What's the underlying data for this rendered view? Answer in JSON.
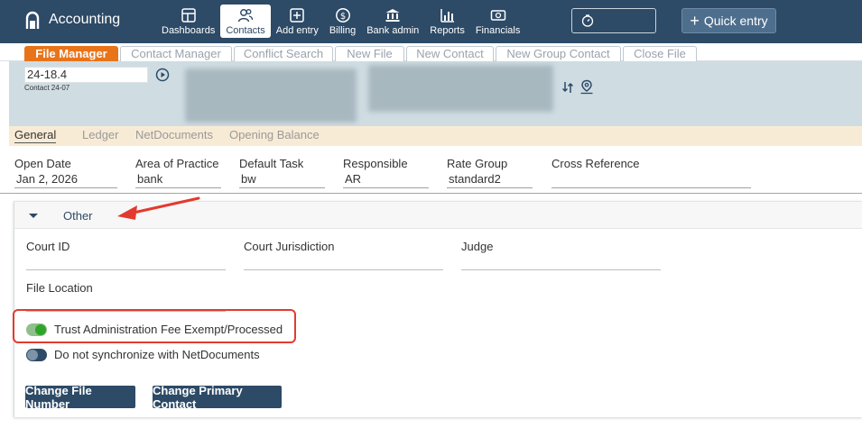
{
  "app": {
    "title": "Accounting",
    "nav": [
      {
        "label": "Dashboards",
        "icon": "dashboard-icon"
      },
      {
        "label": "Contacts",
        "icon": "contacts-icon",
        "active": true
      },
      {
        "label": "Add entry",
        "icon": "add-entry-icon"
      },
      {
        "label": "Billing",
        "icon": "billing-icon"
      },
      {
        "label": "Bank admin",
        "icon": "bank-icon"
      },
      {
        "label": "Reports",
        "icon": "reports-icon"
      },
      {
        "label": "Financials",
        "icon": "financials-icon"
      }
    ],
    "quick_entry_label": "Quick entry"
  },
  "tabs": [
    {
      "label": "File Manager",
      "active": true
    },
    {
      "label": "Contact Manager"
    },
    {
      "label": "Conflict Search"
    },
    {
      "label": "New File"
    },
    {
      "label": "New Contact"
    },
    {
      "label": "New Group Contact"
    },
    {
      "label": "Close File"
    }
  ],
  "file_header": {
    "file_number": "24-18.4",
    "contact_ref": "Contact 24-07"
  },
  "subtabs": [
    {
      "label": "General",
      "active": true
    },
    {
      "label": "Ledger"
    },
    {
      "label": "NetDocuments"
    },
    {
      "label": "Opening Balance"
    }
  ],
  "general_fields": [
    {
      "label": "Open Date",
      "value": "Jan 2, 2026"
    },
    {
      "label": "Area of Practice",
      "value": "bank"
    },
    {
      "label": "Default Task",
      "value": "bw"
    },
    {
      "label": "Responsible",
      "value": "AR"
    },
    {
      "label": "Rate Group",
      "value": "standard2"
    },
    {
      "label": "Cross Reference",
      "value": ""
    }
  ],
  "other": {
    "section_label": "Other",
    "fields": [
      {
        "label": "Court ID",
        "value": ""
      },
      {
        "label": "Court Jurisdiction",
        "value": ""
      },
      {
        "label": "Judge",
        "value": ""
      },
      {
        "label": "File Location",
        "value": ""
      }
    ],
    "toggles": [
      {
        "label": "Trust Administration Fee Exempt/Processed",
        "on": true
      },
      {
        "label": "Do not synchronize with NetDocuments",
        "on": false
      }
    ],
    "buttons": {
      "change_file_number": "Change File Number",
      "change_primary_contact": "Change Primary Contact"
    }
  },
  "colors": {
    "topbar": "#2d4a66",
    "active_tab": "#e8741a",
    "header_panel": "#cfdde3",
    "subtab_bar": "#f8ebd5",
    "annotation": "#e33a2f"
  }
}
